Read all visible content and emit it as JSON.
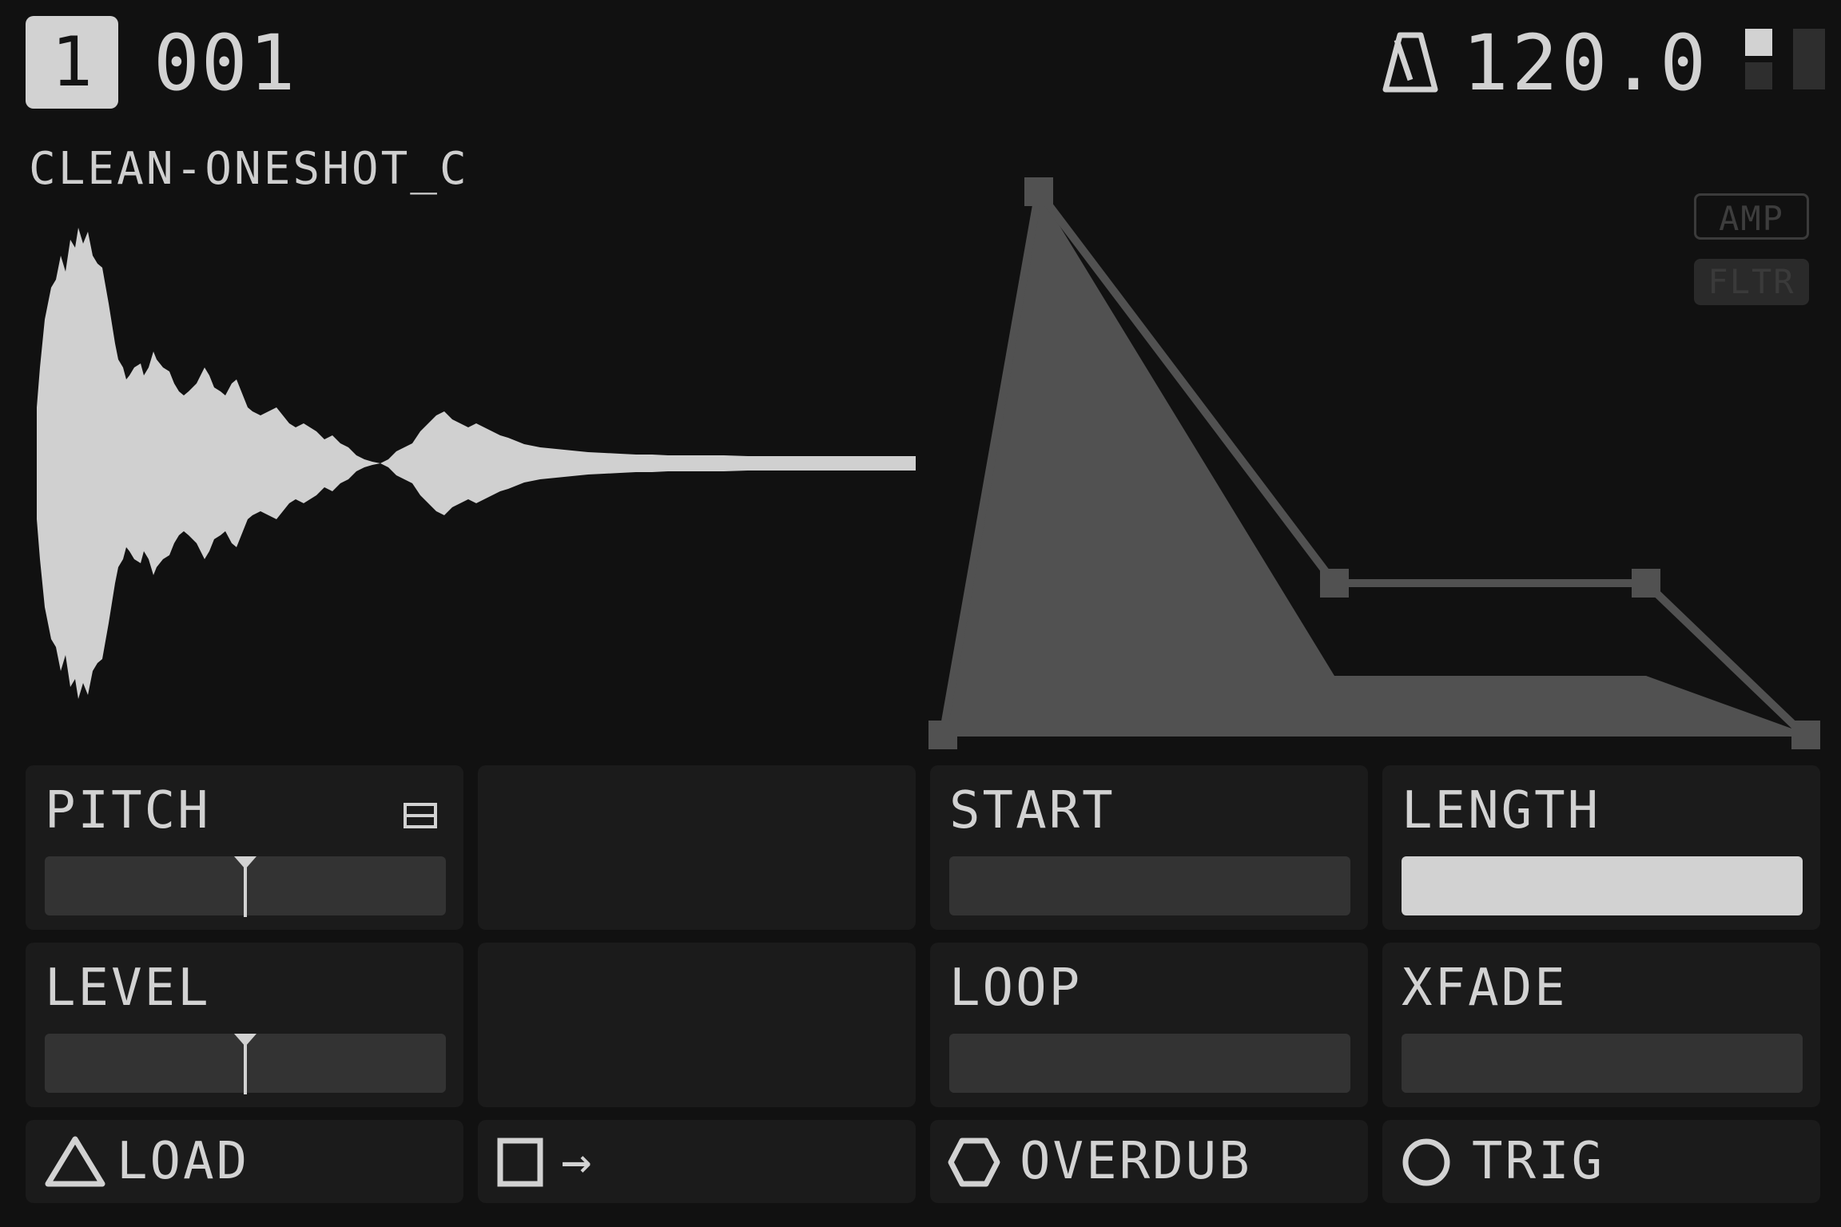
{
  "header": {
    "track": "1",
    "pattern": "001",
    "tempo": "120.0",
    "metronome_icon": "metronome-icon"
  },
  "sample": {
    "name": "CLEAN-ONESHOT_C"
  },
  "envelope": {
    "toggles": {
      "amp": "AMP",
      "fltr": "FLTR"
    },
    "active": "amp"
  },
  "params": {
    "pitch": {
      "label": "PITCH",
      "value": 0.5,
      "icon": "list-icon"
    },
    "level": {
      "label": "LEVEL",
      "value": 0.5
    },
    "start": {
      "label": "START",
      "value": 0.0
    },
    "length": {
      "label": "LENGTH",
      "value": 1.0
    },
    "loop": {
      "label": "LOOP",
      "value": 0.0
    },
    "xfade": {
      "label": "XFADE",
      "value": 0.0
    }
  },
  "buttons": {
    "load": {
      "label": "LOAD",
      "icon": "triangle-icon"
    },
    "square": {
      "label": "→",
      "icon": "square-icon"
    },
    "overdub": {
      "label": "OVERDUB",
      "icon": "hexagon-icon"
    },
    "trig": {
      "label": "TRIG",
      "icon": "circle-icon"
    }
  },
  "colors": {
    "background": "#111111",
    "panel": "#1b1b1b",
    "foreground": "#d2d2d2",
    "envelope_fill": "#515151"
  }
}
